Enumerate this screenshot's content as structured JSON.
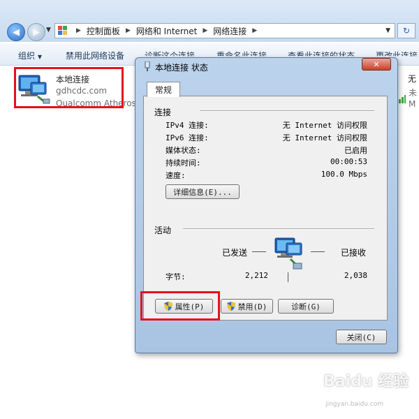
{
  "address_bar": {
    "crumbs": [
      "控制面板",
      "网络和 Internet",
      "网络连接"
    ]
  },
  "toolbar": {
    "organize": "组织",
    "disable_device": "禁用此网络设备",
    "diagnose": "诊断这个连接",
    "rename": "重命名此连接",
    "view_status": "查看此连接的状态",
    "change_settings": "更改此连接"
  },
  "connection": {
    "name": "本地连接",
    "network": "gdhcdc.com",
    "adapter": "Qualcomm Atheros"
  },
  "other_connection": {
    "line1": "无",
    "line2": "未",
    "line3": "M"
  },
  "dialog": {
    "title": "本地连接 状态",
    "tab": "常规",
    "connection_section": "连接",
    "rows": [
      {
        "label": "IPv4 连接:",
        "value": "无 Internet 访问权限"
      },
      {
        "label": "IPv6 连接:",
        "value": "无 Internet 访问权限"
      },
      {
        "label": "媒体状态:",
        "value": "已启用"
      },
      {
        "label": "持续时间:",
        "value": "00:00:53"
      },
      {
        "label": "速度:",
        "value": "100.0 Mbps"
      }
    ],
    "details_button": "详细信息(E)...",
    "activity_section": "活动",
    "sent_label": "已发送",
    "received_label": "已接收",
    "bytes_label": "字节:",
    "bytes_sent": "2,212",
    "bytes_received": "2,038",
    "properties_button": "属性(P)",
    "disable_button": "禁用(D)",
    "diagnose_button": "诊断(G)",
    "close_button": "关闭(C)"
  },
  "watermark": {
    "main": "Baidu 经验",
    "sub": "jingyan.baidu.com"
  },
  "colors": {
    "highlight": "#e1131c",
    "dialog_frame": "#bcd3ec"
  }
}
